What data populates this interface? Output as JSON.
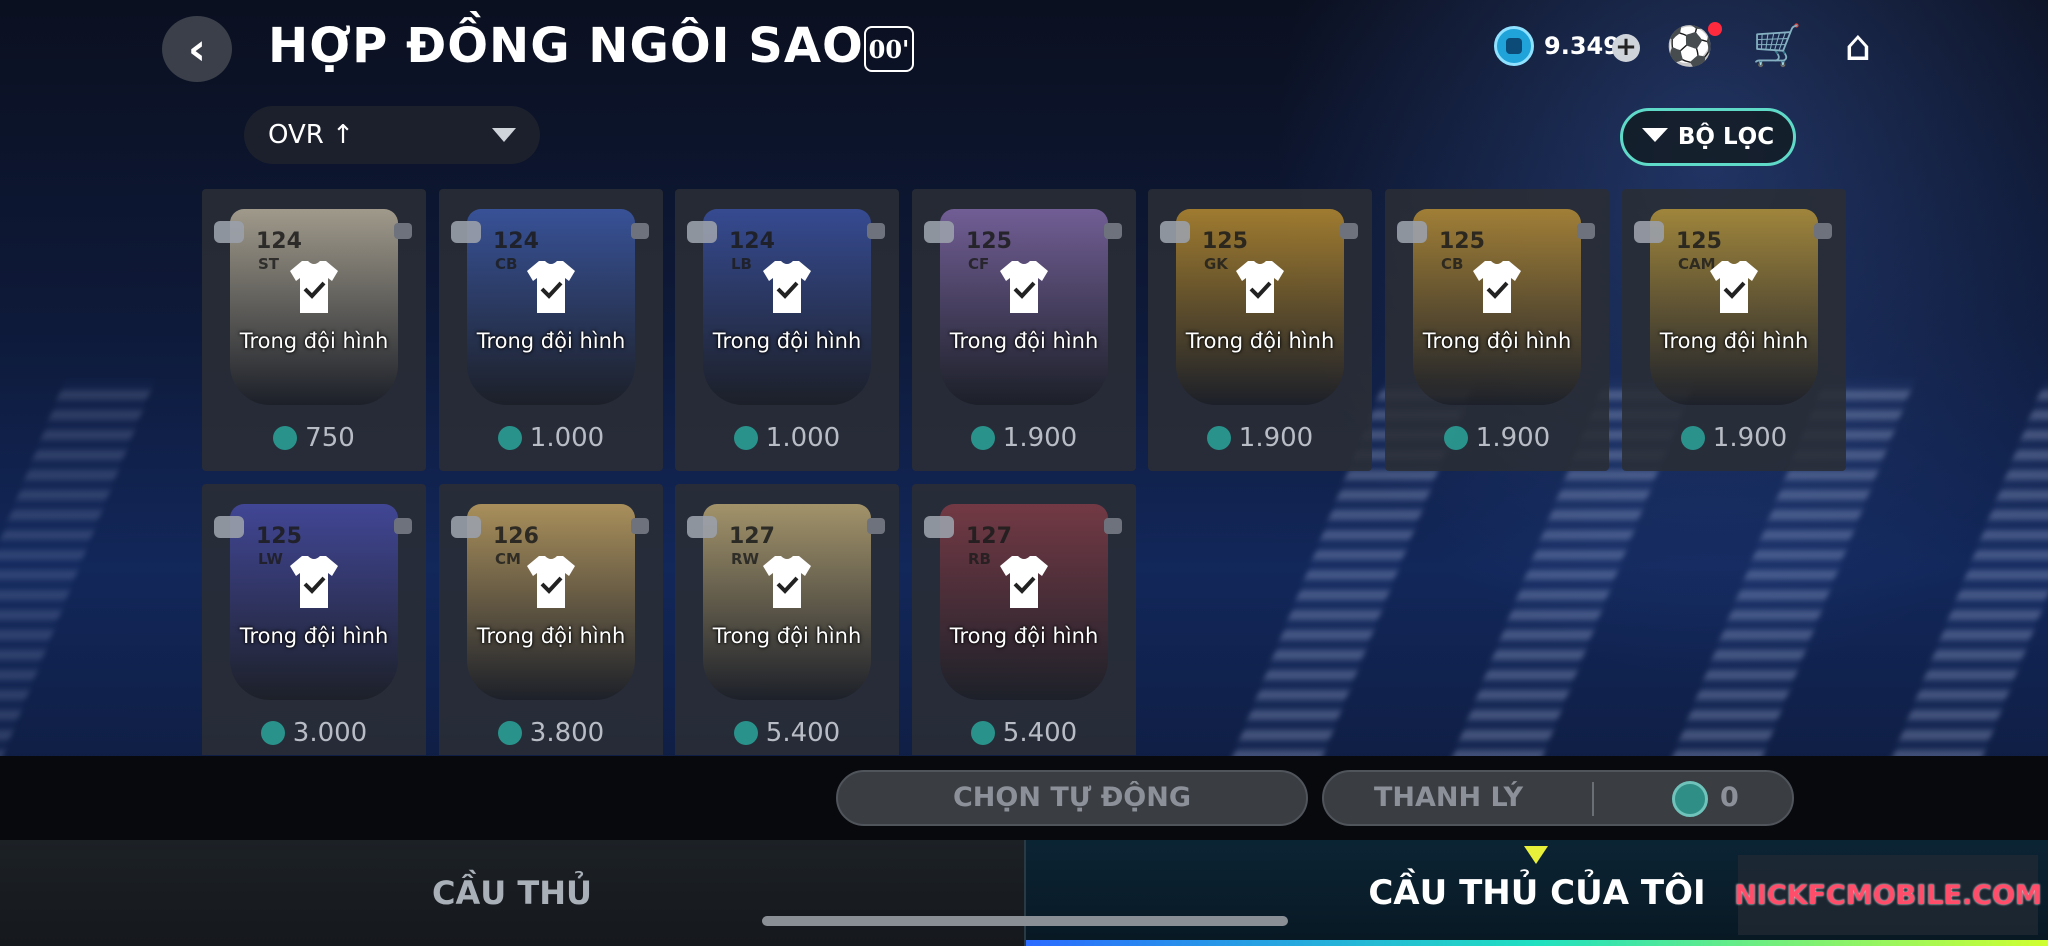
{
  "header": {
    "back_icon": "chevron-left-icon",
    "title": "HỢP ĐỒNG NGÔI SAO",
    "badge": "00'",
    "currency_balance": "9.349",
    "icons": [
      "coin-icon",
      "add-icon",
      "football-icon",
      "cart-icon",
      "home-icon"
    ]
  },
  "toolbar": {
    "sort_label": "OVR ↑",
    "filter_label": "BỘ LỌC"
  },
  "cards": [
    {
      "ovr": "124",
      "position": "ST",
      "status": "Trong đội hình",
      "price": "750",
      "art": "#c9bfa8"
    },
    {
      "ovr": "124",
      "position": "CB",
      "status": "Trong đội hình",
      "price": "1.000",
      "art": "#3e5fb8"
    },
    {
      "ovr": "124",
      "position": "LB",
      "status": "Trong đội hình",
      "price": "1.000",
      "art": "#3b55b0"
    },
    {
      "ovr": "125",
      "position": "CF",
      "status": "Trong đội hình",
      "price": "1.900",
      "art": "#8a6fb5"
    },
    {
      "ovr": "125",
      "position": "GK",
      "status": "Trong đội hình",
      "price": "1.900",
      "art": "#c8962e"
    },
    {
      "ovr": "125",
      "position": "CB",
      "status": "Trong đội hình",
      "price": "1.900",
      "art": "#c99a36"
    },
    {
      "ovr": "125",
      "position": "CAM",
      "status": "Trong đội hình",
      "price": "1.900",
      "art": "#c7a23c"
    },
    {
      "ovr": "125",
      "position": "LW",
      "status": "Trong đội hình",
      "price": "3.000",
      "art": "#4a4fb4"
    },
    {
      "ovr": "126",
      "position": "CM",
      "status": "Trong đội hình",
      "price": "3.800",
      "art": "#d4b066"
    },
    {
      "ovr": "127",
      "position": "RW",
      "status": "Trong đội hình",
      "price": "5.400",
      "art": "#cbb57a"
    },
    {
      "ovr": "127",
      "position": "RB",
      "status": "Trong đội hình",
      "price": "5.400",
      "art": "#8c3e48"
    }
  ],
  "actions": {
    "auto_select_label": "CHỌN TỰ ĐỘNG",
    "sell_label": "THANH LÝ",
    "sell_total": "0"
  },
  "tabs": {
    "players": "CẦU THỦ",
    "my_players": "CẦU THỦ CỦA TÔI"
  },
  "watermark": "NICKFCMOBILE.COM",
  "colors": {
    "accent": "#5fd9c8",
    "active_tab_indicator": "#e8f03a",
    "coin": "#1fa3d9"
  }
}
